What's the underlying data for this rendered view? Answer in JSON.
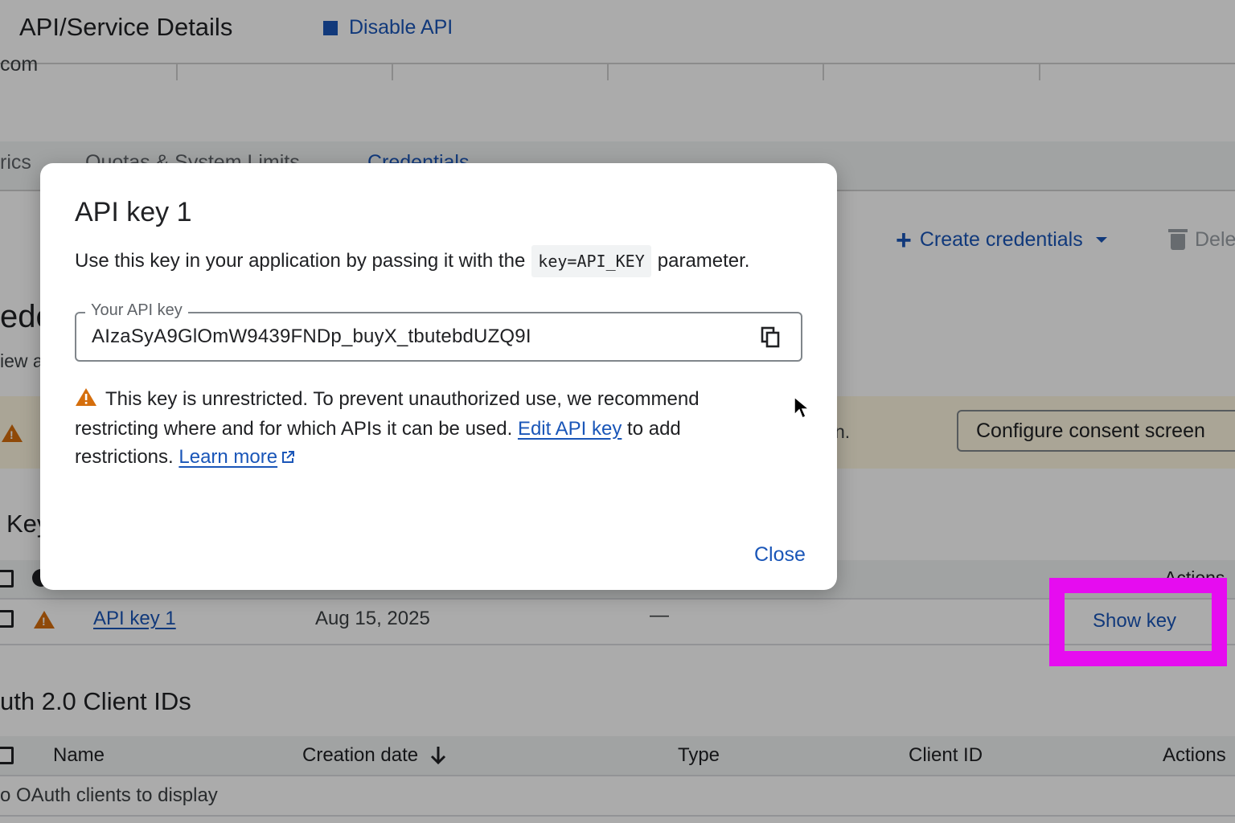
{
  "header": {
    "title": "API/Service Details",
    "disable_label": "Disable API",
    "partial_text": "com"
  },
  "tabs": [
    {
      "label": "rics"
    },
    {
      "label": "Quotas & System Limits"
    },
    {
      "label": "Credentials"
    }
  ],
  "toolbar": {
    "create_label": "Create credentials",
    "delete_label": "Dele"
  },
  "page": {
    "heading_partial": "ede",
    "subtext_partial": "iew a"
  },
  "banner": {
    "text_partial": "n.",
    "consent_label": "Configure consent screen"
  },
  "api_keys": {
    "heading_partial": "Key",
    "actions_header": "Actions",
    "rows": [
      {
        "name": "API key 1",
        "date": "Aug 15, 2025",
        "restriction": "—",
        "action": "Show key"
      }
    ]
  },
  "oauth": {
    "heading": "uth 2.0 Client IDs",
    "columns": [
      "Name",
      "Creation date",
      "Type",
      "Client ID",
      "Actions"
    ],
    "empty_text": "o OAuth clients to display"
  },
  "dialog": {
    "title": "API key 1",
    "desc_before": "Use this key in your application by passing it with the",
    "desc_code": "key=API_KEY",
    "desc_after": "parameter.",
    "field_label": "Your API key",
    "field_value": "AIzaSyA9GlOmW9439FNDp_buyX_tbutebdUZQ9I",
    "warning_text": "This key is unrestricted. To prevent unauthorized use, we recommend restricting where and for which APIs it can be used.",
    "edit_link": "Edit API key",
    "warning_after": "to add restrictions.",
    "learn_more": "Learn more",
    "close_label": "Close"
  },
  "colors": {
    "accent": "#1a56b8",
    "highlight": "#e60cf0",
    "warning": "#d56e0c"
  },
  "icons": [
    "disable-square-icon",
    "plus-icon",
    "dropdown-caret-icon",
    "trash-icon",
    "warning-icon",
    "copy-icon",
    "external-link-icon",
    "sort-arrow-icon",
    "mouse-pointer-icon"
  ]
}
